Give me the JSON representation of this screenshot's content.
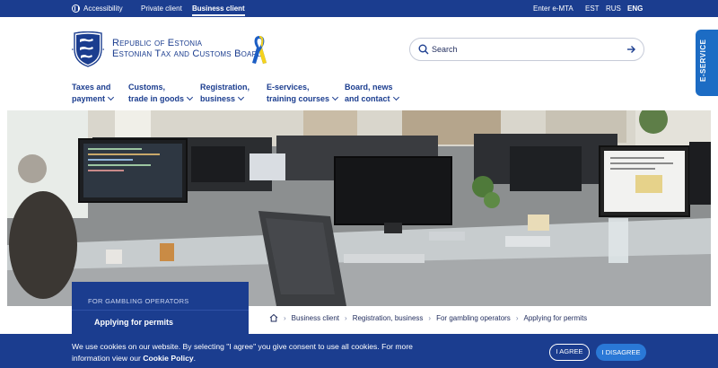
{
  "topbar": {
    "accessibility": "Accessibility",
    "private_client": "Private client",
    "business_client": "Business client",
    "e_mta": "Enter e-MTA",
    "lang_est": "EST",
    "lang_rus": "RUS",
    "lang_eng": "ENG"
  },
  "header": {
    "org_line1": "Republic of Estonia",
    "org_line2": "Estonian Tax and Customs Board",
    "ribbon_colors": [
      "#1c5ec4",
      "#f5d21c"
    ]
  },
  "search": {
    "placeholder": "Search"
  },
  "eservice": {
    "label": "E-SERVICE"
  },
  "nav": [
    {
      "line1": "Taxes and",
      "line2": "payment"
    },
    {
      "line1": "Customs,",
      "line2": "trade in goods"
    },
    {
      "line1": "Registration,",
      "line2": "business"
    },
    {
      "line1": "E-services,",
      "line2": "training courses"
    },
    {
      "line1": "Board, news",
      "line2": "and contact"
    }
  ],
  "section": {
    "label": "FOR GAMBLING OPERATORS",
    "link": "Applying for permits"
  },
  "breadcrumb": [
    "Business client",
    "Registration, business",
    "For gambling operators",
    "Applying for permits"
  ],
  "cookie": {
    "text": "We use cookies on our website. By selecting \"I agree\" you give consent to use all cookies. For more information view our",
    "policy": "Cookie Policy",
    "agree": "I AGREE",
    "disagree": "I DISAGREE"
  },
  "colors": {
    "brand_blue": "#1b3d8f",
    "accent_blue": "#2a78d6"
  }
}
